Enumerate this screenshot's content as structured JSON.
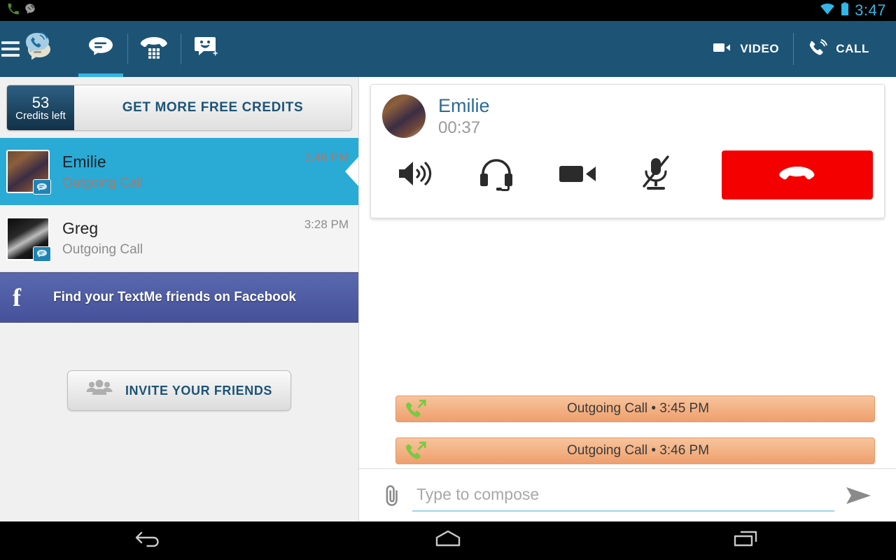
{
  "statusbar": {
    "time": "3:47",
    "icons": [
      "phone-in-call-icon",
      "textme-notification-icon",
      "wifi-icon",
      "battery-icon"
    ]
  },
  "appbar": {
    "menu_icon": "hamburger-menu-icon",
    "logo_icon": "textme-logo-icon",
    "tabs": [
      {
        "name": "tab-messages",
        "icon": "chat-bubble-icon",
        "active": true
      },
      {
        "name": "tab-dialpad",
        "icon": "dialpad-phone-icon",
        "active": false
      },
      {
        "name": "tab-new-message",
        "icon": "smiley-add-icon",
        "active": false
      }
    ],
    "actions": [
      {
        "name": "video-button",
        "label": "VIDEO",
        "icon": "video-camera-icon"
      },
      {
        "name": "call-button",
        "label": "CALL",
        "icon": "phone-call-icon"
      }
    ]
  },
  "sidebar": {
    "credits": {
      "count": "53",
      "caption": "Credits left",
      "cta_label": "GET MORE FREE CREDITS"
    },
    "conversations": [
      {
        "name": "Emilie",
        "preview": "Outgoing Call",
        "time": "3:46 PM",
        "selected": true,
        "badge_icon": "chat-badge-icon"
      },
      {
        "name": "Greg",
        "preview": "Outgoing Call",
        "time": "3:28 PM",
        "selected": false,
        "badge_icon": "chat-badge-icon"
      }
    ],
    "facebook_banner": {
      "label": "Find your TextMe friends on Facebook",
      "icon": "facebook-f-icon"
    },
    "invite_button": {
      "label": "INVITE YOUR FRIENDS",
      "icon": "people-group-icon"
    }
  },
  "call_panel": {
    "contact_name": "Emilie",
    "duration": "00:37",
    "controls": [
      {
        "name": "speaker-button",
        "icon": "speaker-icon",
        "state": "on"
      },
      {
        "name": "headset-button",
        "icon": "headset-icon",
        "state": "off"
      },
      {
        "name": "video-toggle-button",
        "icon": "video-camera-icon",
        "state": "off"
      },
      {
        "name": "mute-button",
        "icon": "microphone-muted-icon",
        "state": "muted"
      }
    ],
    "hangup": {
      "name": "hangup-button",
      "icon": "hangup-phone-icon"
    }
  },
  "thread": {
    "messages": [
      {
        "label": "Outgoing Call • 3:45 PM",
        "icon": "outgoing-call-icon"
      },
      {
        "label": "Outgoing Call • 3:46 PM",
        "icon": "outgoing-call-icon"
      }
    ]
  },
  "compose": {
    "placeholder": "Type to compose",
    "value": "",
    "attach_icon": "paperclip-icon",
    "send_icon": "send-arrow-icon"
  },
  "navbar": {
    "buttons": [
      {
        "name": "nav-back-button",
        "icon": "back-arrow-icon"
      },
      {
        "name": "nav-home-button",
        "icon": "home-icon"
      },
      {
        "name": "nav-recents-button",
        "icon": "recent-apps-icon"
      }
    ]
  },
  "colors": {
    "appbar": "#1d5476",
    "accent": "#33b5e5",
    "selected_row": "#29abd6",
    "facebook": "#45529b",
    "hangup": "#f40000",
    "call_bubble": "#ef9f6d"
  }
}
